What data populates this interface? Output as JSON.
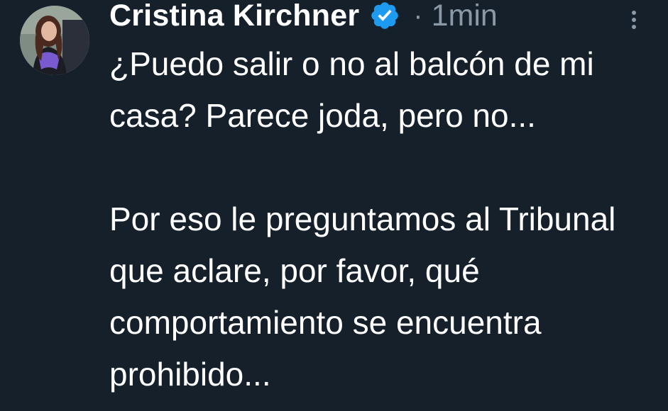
{
  "tweet": {
    "display_name": "Cristina Kirchner",
    "verified_icon": "verified-badge-icon",
    "separator": "·",
    "timestamp": "1min",
    "more_icon": "more-vertical-icon",
    "text_paragraph_1": "¿Puedo salir o no al balcón de mi casa? Parece joda, pero no...",
    "text_paragraph_2": "Por eso le preguntamos al Tribunal que aclare, por favor, qué comportamiento se encuentra prohibido..."
  },
  "colors": {
    "background": "#15202b",
    "primary_text": "#ffffff",
    "secondary_text": "#8b98a5",
    "verified_blue": "#1d9bf0"
  }
}
